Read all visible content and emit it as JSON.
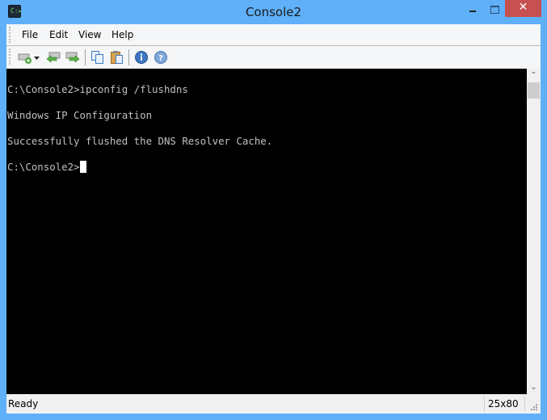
{
  "window": {
    "title": "Console2",
    "app_icon": "console-app-icon",
    "close_glyph": "✕"
  },
  "menu": [
    {
      "label": "File"
    },
    {
      "label": "Edit"
    },
    {
      "label": "View"
    },
    {
      "label": "Help"
    }
  ],
  "toolbar": [
    {
      "name": "new-tab-button",
      "icon": "new-tab-icon"
    },
    {
      "name": "new-tab-dropdown-button",
      "icon": "chevron-down-icon"
    },
    {
      "name": "previous-tab-button",
      "icon": "arrow-left-icon"
    },
    {
      "name": "next-tab-button",
      "icon": "arrow-right-icon"
    },
    {
      "name": "copy-button",
      "icon": "copy-icon"
    },
    {
      "name": "paste-button",
      "icon": "paste-icon"
    },
    {
      "name": "about-button",
      "icon": "info-icon"
    },
    {
      "name": "help-button",
      "icon": "help-icon"
    }
  ],
  "console": {
    "lines": [
      "C:\\Console2>ipconfig /flushdns",
      "Windows IP Configuration",
      "Successfully flushed the DNS Resolver Cache.",
      "C:\\Console2>"
    ]
  },
  "scrollbar": {
    "up": "⌃",
    "down": "⌄"
  },
  "status": {
    "text": "Ready",
    "size": "25x80"
  }
}
